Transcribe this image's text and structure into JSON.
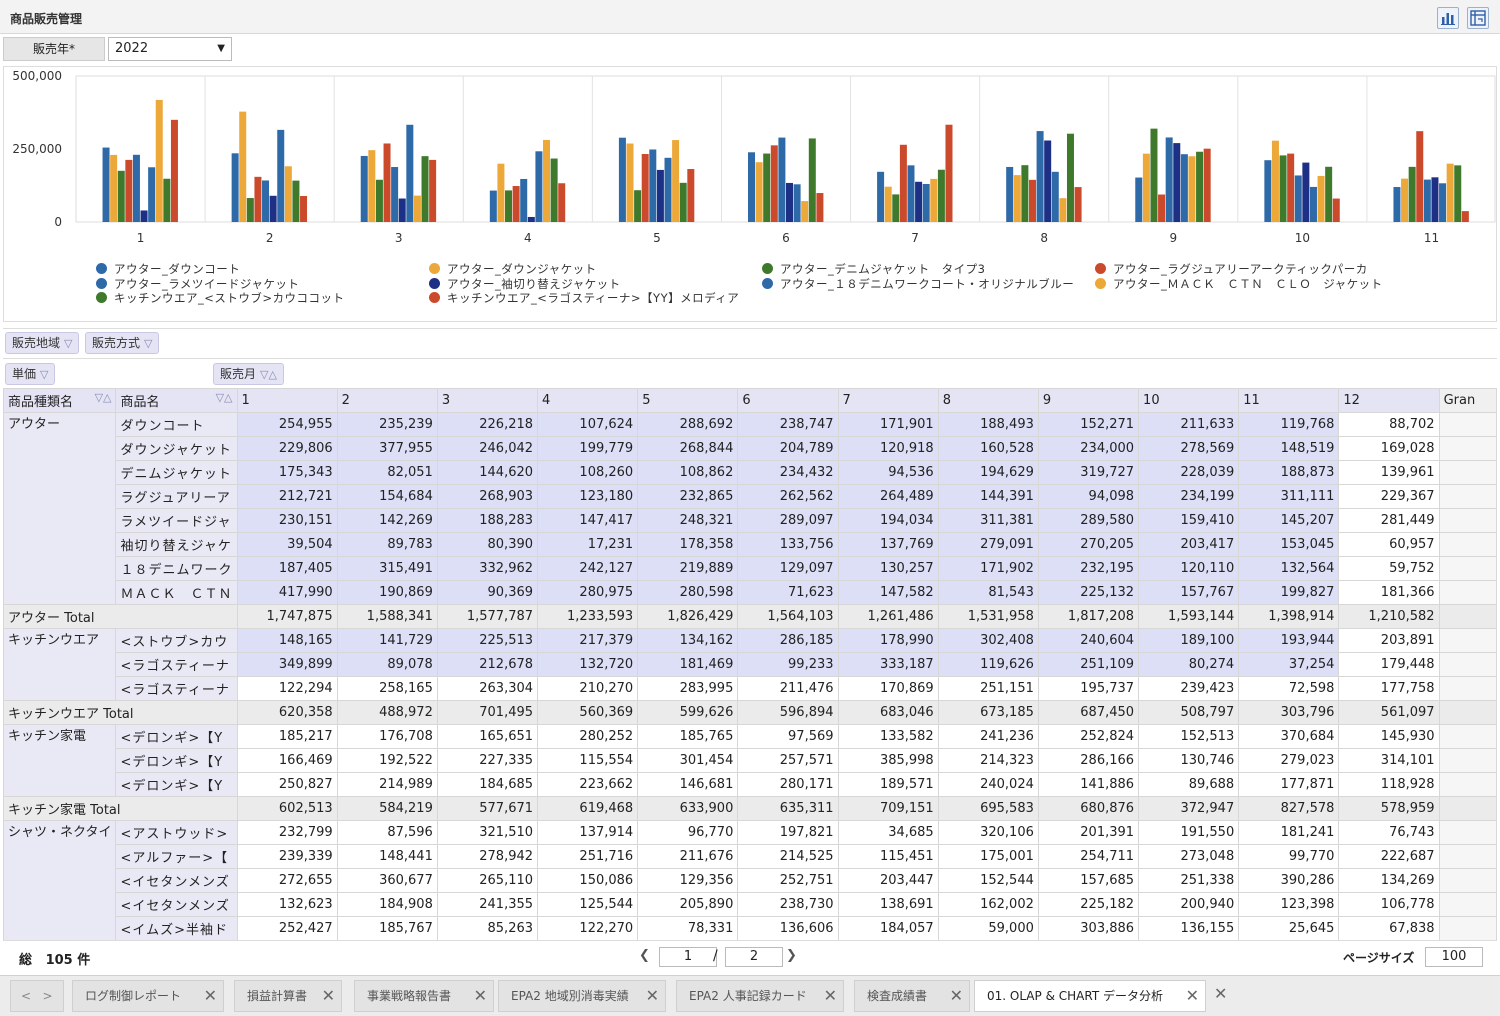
{
  "window": {
    "title": "商品販売管理"
  },
  "filter": {
    "label": "販売年*",
    "value": "2022"
  },
  "chart_data": {
    "type": "bar",
    "categories": [
      "1",
      "2",
      "3",
      "4",
      "5",
      "6",
      "7",
      "8",
      "9",
      "10",
      "11"
    ],
    "ylim": [
      0,
      500000
    ],
    "yticks": [
      "500,000",
      "250,000",
      "0"
    ],
    "series": [
      {
        "name": "アウター_ダウンコート",
        "color": "#2e6aa8",
        "values": [
          254955,
          235239,
          226218,
          107624,
          288692,
          238747,
          171901,
          188493,
          152271,
          211633,
          119768
        ]
      },
      {
        "name": "アウター_ダウンジャケット",
        "color": "#eda83a",
        "values": [
          229806,
          377955,
          246042,
          199779,
          268844,
          204789,
          120918,
          160528,
          234000,
          278569,
          148519
        ]
      },
      {
        "name": "アウター_デニムジャケット タイプ3",
        "color": "#3f7a2c",
        "values": [
          175343,
          82051,
          144620,
          108260,
          108862,
          234432,
          94536,
          194629,
          319727,
          228039,
          188873
        ]
      },
      {
        "name": "アウター_ラグジュアリーアークティックパーカ",
        "color": "#cc4a2c",
        "values": [
          212721,
          154684,
          268903,
          123180,
          232865,
          262562,
          264489,
          144391,
          94098,
          234199,
          311111
        ]
      },
      {
        "name": "アウター_ラメツイードジャケット",
        "color": "#2e6aa8",
        "values": [
          230151,
          142269,
          188283,
          147417,
          248321,
          289097,
          194034,
          311381,
          289580,
          159410,
          145207
        ]
      },
      {
        "name": "アウター_袖切り替えジャケット",
        "color": "#1e2f86",
        "values": [
          39504,
          89783,
          80390,
          17231,
          178358,
          133756,
          137769,
          279091,
          270205,
          203417,
          153045
        ]
      },
      {
        "name": "アウター_18デニムワークコート・オリジナルブルー",
        "color": "#2e6aa8",
        "values": [
          187405,
          315491,
          332962,
          242127,
          219889,
          129097,
          130257,
          171902,
          232195,
          120110,
          132564
        ]
      },
      {
        "name": "アウター_MACK CTN CLO ジャケット",
        "color": "#eda83a",
        "values": [
          417990,
          190869,
          90369,
          280975,
          280598,
          71623,
          147582,
          81543,
          225132,
          157767,
          199827
        ]
      },
      {
        "name": "キッチンウエア_<ストウブ>カウココット",
        "color": "#3f7a2c",
        "values": [
          148165,
          141729,
          225513,
          217379,
          134162,
          286185,
          178990,
          302408,
          240604,
          189100,
          193944
        ]
      },
      {
        "name": "キッチンウエア_<ラゴスティーナ>【YY】メロディア",
        "color": "#cc4a2c",
        "values": [
          349899,
          89078,
          212678,
          132720,
          181469,
          99233,
          333187,
          119626,
          251109,
          80274,
          37254
        ]
      }
    ]
  },
  "legend": {
    "col1": [
      "アウター_ダウンコート",
      "アウター_ラメツイードジャケット",
      "キッチンウエア_<ストウブ>カウココット"
    ],
    "col2": [
      "アウター_ダウンジャケット",
      "アウター_袖切り替えジャケット",
      "キッチンウエア_<ラゴスティーナ>【YY】メロディア"
    ],
    "col3": [
      "アウター_デニムジャケット　タイプ3",
      "アウター_１８デニムワークコート・オリジナルブルー"
    ],
    "col4": [
      "アウター_ラグジュアリーアークティックパーカ",
      "アウター_ＭＡＣＫ　ＣＴＮ　ＣＬＯ　ジャケット"
    ],
    "col1_colors": [
      "#2e6aa8",
      "#2e6aa8",
      "#3f7a2c"
    ],
    "col2_colors": [
      "#eda83a",
      "#1e2f86",
      "#cc4a2c"
    ],
    "col3_colors": [
      "#3f7a2c",
      "#2e6aa8"
    ],
    "col4_colors": [
      "#cc4a2c",
      "#eda83a"
    ]
  },
  "pivot": {
    "filter_chips": [
      "販売地域",
      "販売方式"
    ],
    "value_chip": "単価",
    "column_chip": "販売月",
    "row_headers": [
      "商品種類名",
      "商品名"
    ],
    "month_headers": [
      "1",
      "2",
      "3",
      "4",
      "5",
      "6",
      "7",
      "8",
      "9",
      "10",
      "11",
      "12",
      "Gran"
    ],
    "rows": [
      {
        "cat": "アウター",
        "prod": "ダウンコート",
        "hl": true,
        "v": [
          "254,955",
          "235,239",
          "226,218",
          "107,624",
          "288,692",
          "238,747",
          "171,901",
          "188,493",
          "152,271",
          "211,633",
          "119,768",
          "88,702"
        ]
      },
      {
        "cat": "",
        "prod": "ダウンジャケット",
        "hl": true,
        "v": [
          "229,806",
          "377,955",
          "246,042",
          "199,779",
          "268,844",
          "204,789",
          "120,918",
          "160,528",
          "234,000",
          "278,569",
          "148,519",
          "169,028"
        ]
      },
      {
        "cat": "",
        "prod": "デニムジャケット",
        "hl": true,
        "v": [
          "175,343",
          "82,051",
          "144,620",
          "108,260",
          "108,862",
          "234,432",
          "94,536",
          "194,629",
          "319,727",
          "228,039",
          "188,873",
          "139,961"
        ]
      },
      {
        "cat": "",
        "prod": "ラグジュアリーア",
        "hl": true,
        "v": [
          "212,721",
          "154,684",
          "268,903",
          "123,180",
          "232,865",
          "262,562",
          "264,489",
          "144,391",
          "94,098",
          "234,199",
          "311,111",
          "229,367"
        ]
      },
      {
        "cat": "",
        "prod": "ラメツイードジャ",
        "hl": true,
        "v": [
          "230,151",
          "142,269",
          "188,283",
          "147,417",
          "248,321",
          "289,097",
          "194,034",
          "311,381",
          "289,580",
          "159,410",
          "145,207",
          "281,449"
        ]
      },
      {
        "cat": "",
        "prod": "袖切り替えジャケ",
        "hl": true,
        "v": [
          "39,504",
          "89,783",
          "80,390",
          "17,231",
          "178,358",
          "133,756",
          "137,769",
          "279,091",
          "270,205",
          "203,417",
          "153,045",
          "60,957"
        ]
      },
      {
        "cat": "",
        "prod": "１８デニムワーク",
        "hl": true,
        "v": [
          "187,405",
          "315,491",
          "332,962",
          "242,127",
          "219,889",
          "129,097",
          "130,257",
          "171,902",
          "232,195",
          "120,110",
          "132,564",
          "59,752"
        ]
      },
      {
        "cat": "",
        "prod": "ＭＡＣＫ　ＣＴＮ",
        "hl": true,
        "v": [
          "417,990",
          "190,869",
          "90,369",
          "280,975",
          "280,598",
          "71,623",
          "147,582",
          "81,543",
          "225,132",
          "157,767",
          "199,827",
          "181,366"
        ]
      },
      {
        "total": "アウター Total",
        "v": [
          "1,747,875",
          "1,588,341",
          "1,577,787",
          "1,233,593",
          "1,826,429",
          "1,564,103",
          "1,261,486",
          "1,531,958",
          "1,817,208",
          "1,593,144",
          "1,398,914",
          "1,210,582"
        ]
      },
      {
        "cat": "キッチンウエア",
        "prod": "<ストウブ>カウ",
        "hl": true,
        "v": [
          "148,165",
          "141,729",
          "225,513",
          "217,379",
          "134,162",
          "286,185",
          "178,990",
          "302,408",
          "240,604",
          "189,100",
          "193,944",
          "203,891"
        ]
      },
      {
        "cat": "",
        "prod": "<ラゴスティーナ",
        "hl": true,
        "v": [
          "349,899",
          "89,078",
          "212,678",
          "132,720",
          "181,469",
          "99,233",
          "333,187",
          "119,626",
          "251,109",
          "80,274",
          "37,254",
          "179,448"
        ]
      },
      {
        "cat": "",
        "prod": "<ラゴスティーナ",
        "hl": false,
        "v": [
          "122,294",
          "258,165",
          "263,304",
          "210,270",
          "283,995",
          "211,476",
          "170,869",
          "251,151",
          "195,737",
          "239,423",
          "72,598",
          "177,758"
        ]
      },
      {
        "total": "キッチンウエア Total",
        "v": [
          "620,358",
          "488,972",
          "701,495",
          "560,369",
          "599,626",
          "596,894",
          "683,046",
          "673,185",
          "687,450",
          "508,797",
          "303,796",
          "561,097"
        ]
      },
      {
        "cat": "キッチン家電",
        "prod": "<デロンギ>【Y",
        "hl": false,
        "v": [
          "185,217",
          "176,708",
          "165,651",
          "280,252",
          "185,765",
          "97,569",
          "133,582",
          "241,236",
          "252,824",
          "152,513",
          "370,684",
          "145,930"
        ]
      },
      {
        "cat": "",
        "prod": "<デロンギ>【Y",
        "hl": false,
        "v": [
          "166,469",
          "192,522",
          "227,335",
          "115,554",
          "301,454",
          "257,571",
          "385,998",
          "214,323",
          "286,166",
          "130,746",
          "279,023",
          "314,101"
        ]
      },
      {
        "cat": "",
        "prod": "<デロンギ>【Y",
        "hl": false,
        "v": [
          "250,827",
          "214,989",
          "184,685",
          "223,662",
          "146,681",
          "280,171",
          "189,571",
          "240,024",
          "141,886",
          "89,688",
          "177,871",
          "118,928"
        ]
      },
      {
        "total": "キッチン家電 Total",
        "v": [
          "602,513",
          "584,219",
          "577,671",
          "619,468",
          "633,900",
          "635,311",
          "709,151",
          "695,583",
          "680,876",
          "372,947",
          "827,578",
          "578,959"
        ]
      },
      {
        "cat": "シャツ・ネクタイ",
        "prod": "<アストウッド>",
        "hl": false,
        "v": [
          "232,799",
          "87,596",
          "321,510",
          "137,914",
          "96,770",
          "197,821",
          "34,685",
          "320,106",
          "201,391",
          "191,550",
          "181,241",
          "76,743"
        ]
      },
      {
        "cat": "",
        "prod": "<アルファー>【",
        "hl": false,
        "v": [
          "239,339",
          "148,441",
          "278,942",
          "251,716",
          "211,676",
          "214,525",
          "115,451",
          "175,001",
          "254,711",
          "273,048",
          "99,770",
          "222,687"
        ]
      },
      {
        "cat": "",
        "prod": "<イセタンメンズ",
        "hl": false,
        "v": [
          "272,655",
          "360,677",
          "265,110",
          "150,086",
          "129,356",
          "252,751",
          "203,447",
          "152,544",
          "157,685",
          "251,338",
          "390,286",
          "134,269"
        ]
      },
      {
        "cat": "",
        "prod": "<イセタンメンズ",
        "hl": false,
        "v": [
          "132,623",
          "184,908",
          "241,355",
          "125,544",
          "205,890",
          "238,730",
          "138,691",
          "162,002",
          "225,182",
          "200,940",
          "123,398",
          "106,778"
        ]
      },
      {
        "cat": "",
        "prod": "<イムズ>半袖ド",
        "hl": false,
        "v": [
          "252,427",
          "185,767",
          "85,263",
          "122,270",
          "78,331",
          "136,606",
          "184,057",
          "59,000",
          "303,886",
          "136,155",
          "25,645",
          "67,838"
        ]
      }
    ]
  },
  "footer": {
    "total_label": "総",
    "total_count": "105",
    "total_unit": "件",
    "page": "1",
    "page_sep": "/",
    "pages": "2",
    "page_size_label": "ページサイズ",
    "page_size": "100"
  },
  "tabs": [
    {
      "label": "ログ制御レポート"
    },
    {
      "label": "損益計算書"
    },
    {
      "label": "事業戦略報告書"
    },
    {
      "label": "EPA2 地域別消毒実績"
    },
    {
      "label": "EPA2 人事記録カード"
    },
    {
      "label": "検査成績書"
    },
    {
      "label": "01. OLAP & CHART データ分析"
    }
  ]
}
